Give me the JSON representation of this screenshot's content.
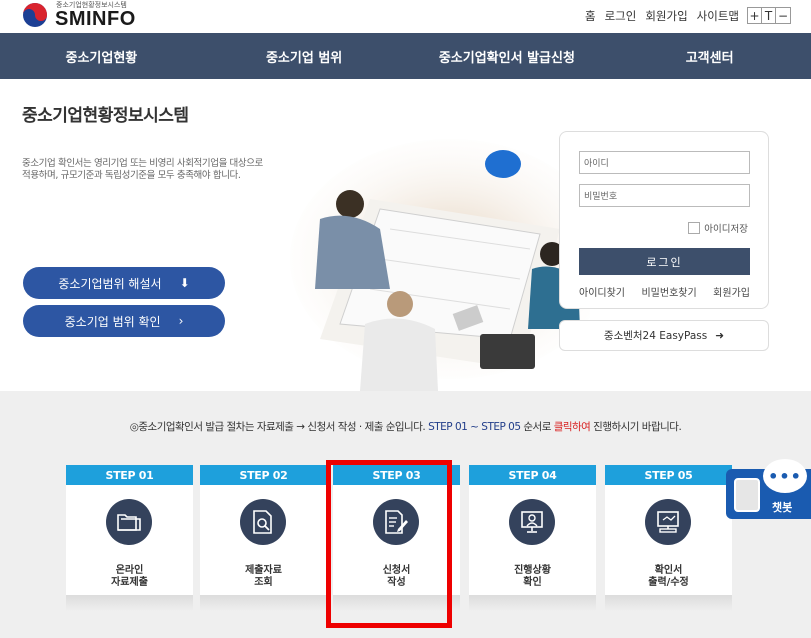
{
  "header": {
    "logo_small": "중소기업현황정보시스템",
    "logo_text": "SMINFO",
    "util": [
      "홈",
      "로그인",
      "회원가입",
      "사이트맵"
    ],
    "font_controls": [
      "+",
      "T",
      "−"
    ]
  },
  "nav": {
    "items": [
      "중소기업현황",
      "중소기업 범위",
      "중소기업확인서 발급신청",
      "고객센터"
    ]
  },
  "hero": {
    "title": "중소기업현황정보시스템",
    "description": "중소기업 확인서는 영리기업 또는 비영리 사회적기업을 대상으로 적용하며, 규모기준과 독립성기준을 모두 충족해야 합니다.",
    "btn_guide": "중소기업범위 해설서",
    "btn_check": "중소기업 범위 확인"
  },
  "login": {
    "id_placeholder": "아이디",
    "pw_placeholder": "비밀번호",
    "save_id": "아이디저장",
    "button": "로그인",
    "links": [
      "아이디찾기",
      "비밀번호찾기",
      "회원가입"
    ],
    "easypass": "중소벤처24 EasyPass"
  },
  "notice": {
    "prefix": "◎중소기업확인서 발급 절차는 자료제출 → 신청서 작성 · 제출 순입니다. ",
    "steps_ref": "STEP 01 ~ STEP 05",
    "mid": " 순서로 ",
    "click": "클릭하여",
    "suffix": " 진행하시기 바랍니다."
  },
  "steps": [
    {
      "tag": "STEP 01",
      "line1": "온라인",
      "line2": "자료제출",
      "icon": "folder-icon"
    },
    {
      "tag": "STEP 02",
      "line1": "제출자료",
      "line2": "조회",
      "icon": "document-search-icon"
    },
    {
      "tag": "STEP 03",
      "line1": "신청서",
      "line2": "작성",
      "icon": "document-edit-icon"
    },
    {
      "tag": "STEP 04",
      "line1": "진행상황",
      "line2": "확인",
      "icon": "monitor-user-icon"
    },
    {
      "tag": "STEP 05",
      "line1": "확인서",
      "line2": "출력/수정",
      "icon": "computer-icon"
    }
  ],
  "chatbot": {
    "label": "챗봇",
    "bubble": "•••"
  },
  "colors": {
    "nav": "#3d4f6b",
    "pill": "#2d56a3",
    "step_tag": "#1ea0dc",
    "highlight": "#ee0000"
  }
}
